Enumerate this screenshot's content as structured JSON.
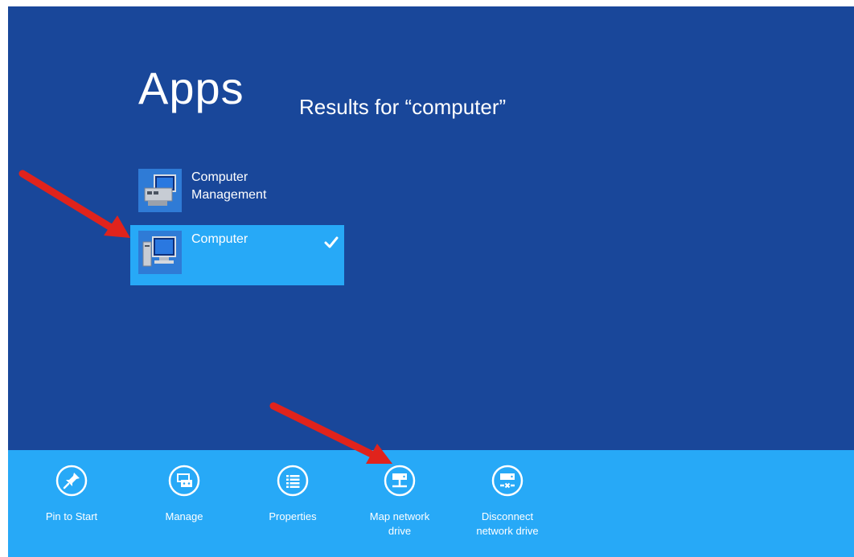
{
  "heading": {
    "title": "Apps",
    "subtitle": "Results for “computer”"
  },
  "results": [
    {
      "label_line1": "Computer",
      "label_line2": "Management",
      "icon": "computer-management-icon",
      "selected": false
    },
    {
      "label_line1": "Computer",
      "label_line2": "",
      "icon": "computer-icon",
      "selected": true
    }
  ],
  "appbar": {
    "commands": [
      {
        "line1": "Pin to Start",
        "line2": "",
        "icon": "pin-icon"
      },
      {
        "line1": "Manage",
        "line2": "",
        "icon": "manage-icon"
      },
      {
        "line1": "Properties",
        "line2": "",
        "icon": "properties-icon"
      },
      {
        "line1": "Map network",
        "line2": "drive",
        "icon": "map-network-drive-icon"
      },
      {
        "line1": "Disconnect",
        "line2": "network drive",
        "icon": "disconnect-network-drive-icon"
      }
    ]
  },
  "colors": {
    "background": "#19479a",
    "accent": "#27a9f7",
    "annotation_arrow": "#e0231c"
  }
}
